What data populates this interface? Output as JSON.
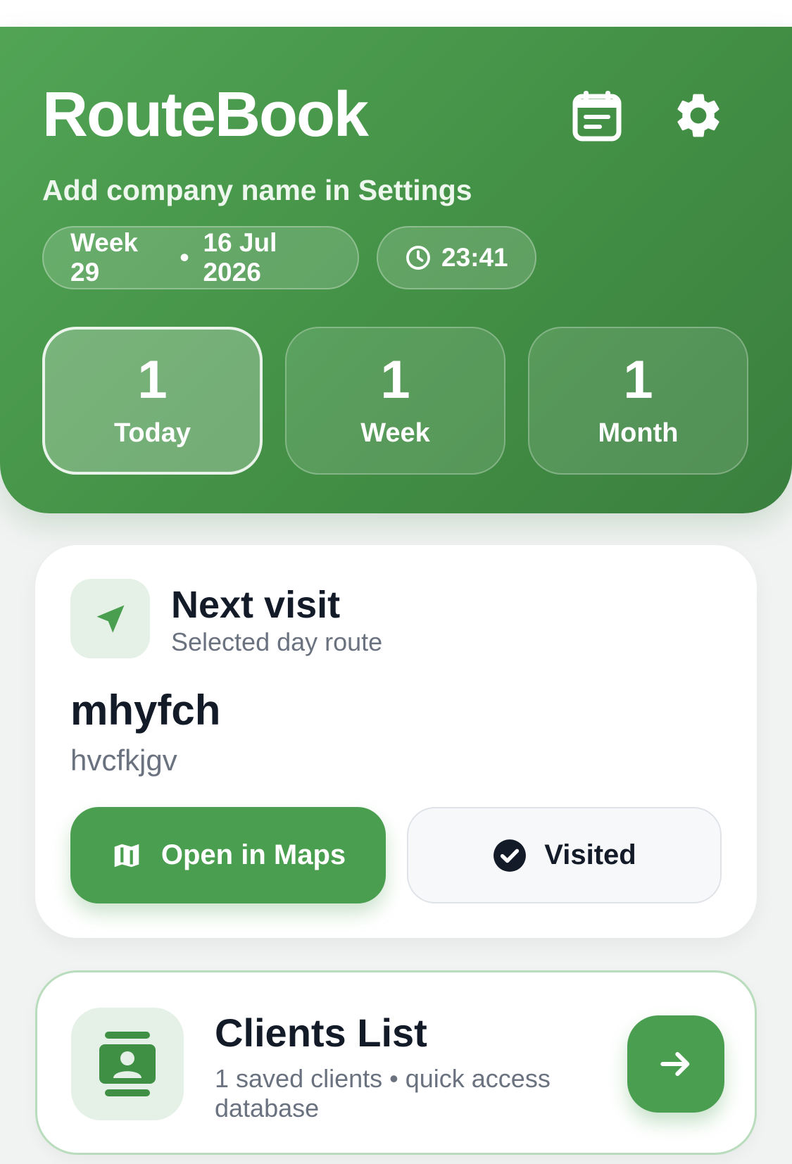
{
  "header": {
    "app_title": "RouteBook",
    "subtitle": "Add company name in Settings",
    "week_label": "Week 29",
    "separator": "•",
    "date_label": "16 Jul 2026",
    "time_label": "23:41",
    "icons": {
      "calendar": "calendar-icon",
      "settings": "gear-icon",
      "clock": "clock-icon"
    }
  },
  "stats": [
    {
      "value": "1",
      "label": "Today",
      "active": true
    },
    {
      "value": "1",
      "label": "Week",
      "active": false
    },
    {
      "value": "1",
      "label": "Month",
      "active": false
    }
  ],
  "next_visit": {
    "title": "Next visit",
    "subtitle": "Selected day route",
    "client_name": "mhyfch",
    "client_address": "hvcfkjgv",
    "maps_button": "Open in Maps",
    "visited_button": "Visited",
    "icons": {
      "nav": "navigation-arrow-icon",
      "maps": "map-icon",
      "visited": "check-circle-icon"
    }
  },
  "clients_list": {
    "title": "Clients List",
    "subtitle": "1 saved clients • quick access database",
    "icons": {
      "contacts": "contacts-icon",
      "open": "arrow-right-icon"
    }
  },
  "colors": {
    "primary": "#4a9e50",
    "header_gradient_start": "#52a455",
    "header_gradient_end": "#3a7f3e",
    "text_dark": "#131a28",
    "text_muted": "#6a7280",
    "icon_tint_bg": "#e5f1e6"
  }
}
